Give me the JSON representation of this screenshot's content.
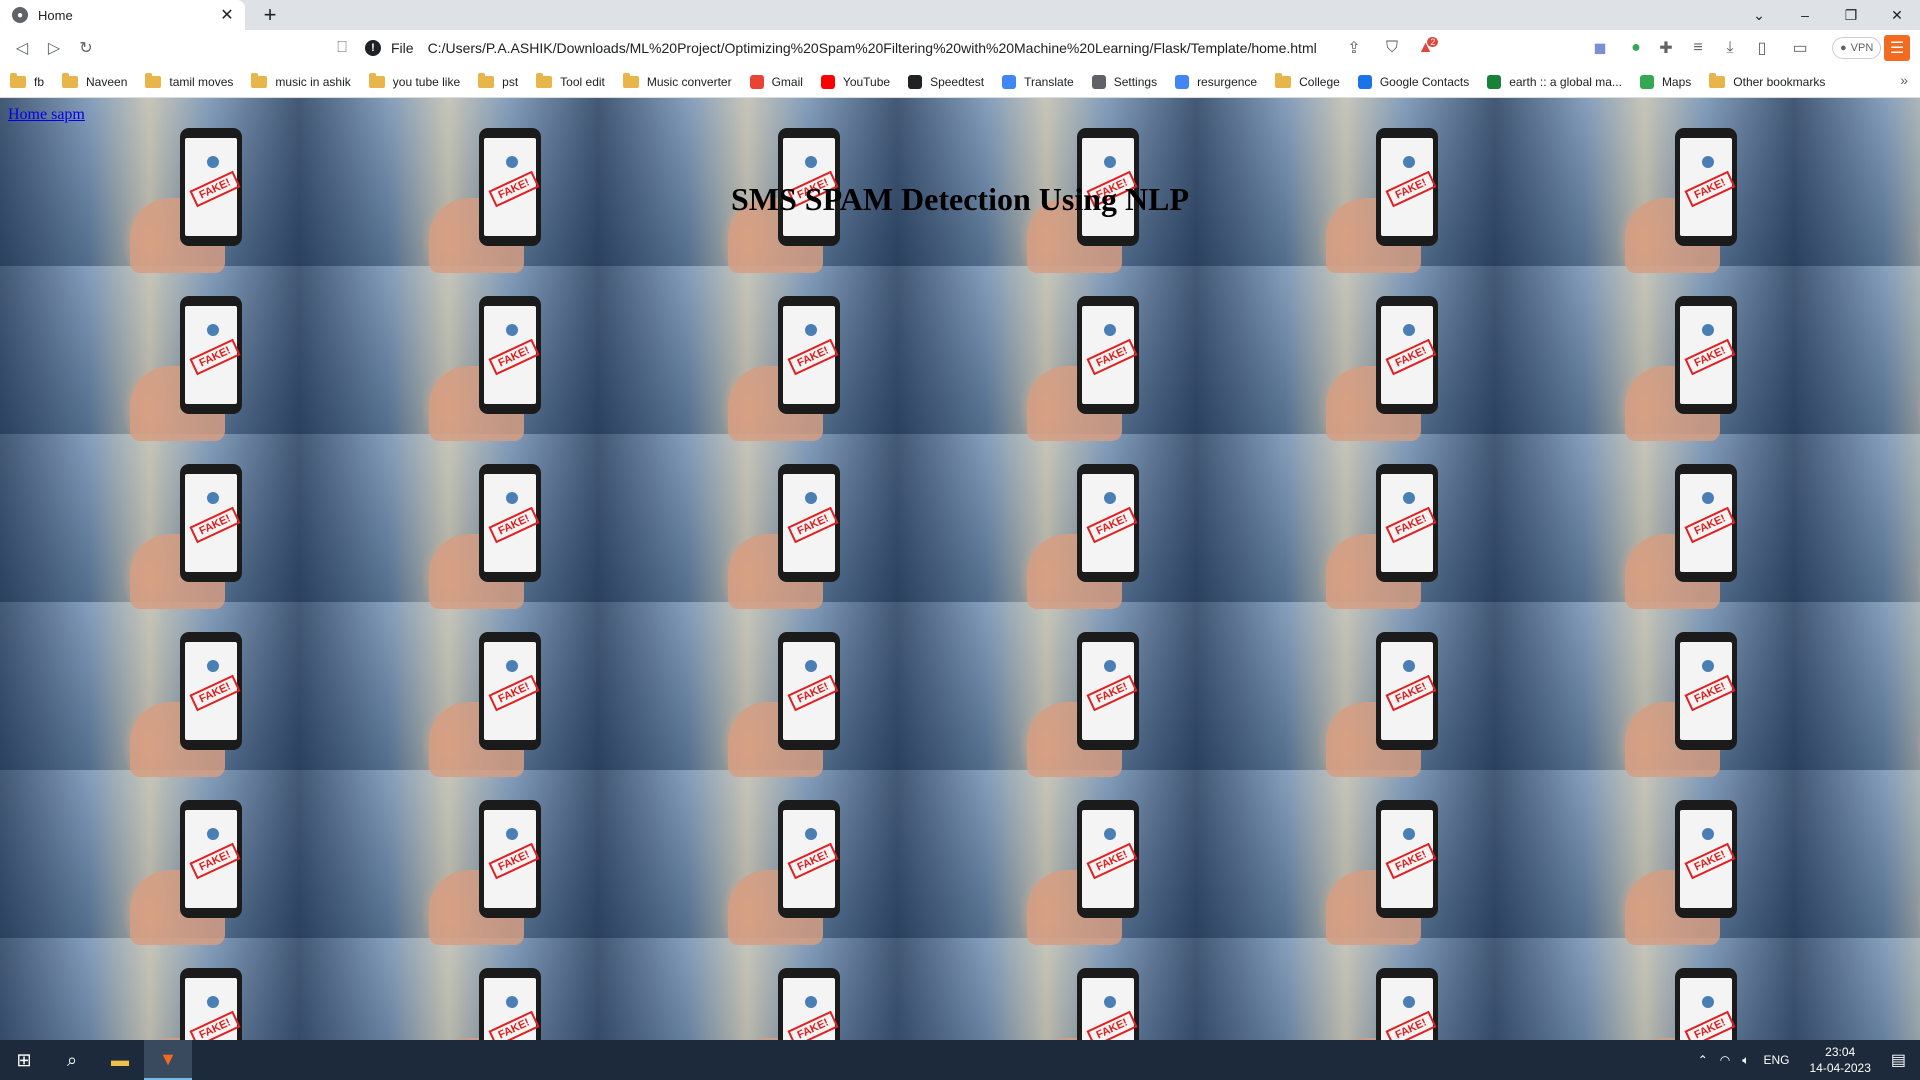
{
  "tab": {
    "title": "Home"
  },
  "address": {
    "scheme": "File",
    "url": "C:/Users/P.A.ASHIK/Downloads/ML%20Project/Optimizing%20Spam%20Filtering%20with%20Machine%20Learning/Flask/Template/home.html"
  },
  "bookmarks": [
    {
      "label": "fb",
      "icon": "folder"
    },
    {
      "label": "Naveen",
      "icon": "folder"
    },
    {
      "label": "tamil moves",
      "icon": "folder"
    },
    {
      "label": "music in ashik",
      "icon": "folder"
    },
    {
      "label": "you tube like",
      "icon": "folder"
    },
    {
      "label": "pst",
      "icon": "folder"
    },
    {
      "label": "Tool edit",
      "icon": "folder"
    },
    {
      "label": "Music converter",
      "icon": "folder"
    },
    {
      "label": "Gmail",
      "icon": "gmail",
      "color": "#ea4335"
    },
    {
      "label": "YouTube",
      "icon": "youtube",
      "color": "#ff0000"
    },
    {
      "label": "Speedtest",
      "icon": "speedtest",
      "color": "#202124"
    },
    {
      "label": "Translate",
      "icon": "translate",
      "color": "#4285f4"
    },
    {
      "label": "Settings",
      "icon": "gear",
      "color": "#5f6368"
    },
    {
      "label": "resurgence",
      "icon": "google",
      "color": "#4285f4"
    },
    {
      "label": "College",
      "icon": "folder"
    },
    {
      "label": "Google Contacts",
      "icon": "contacts",
      "color": "#1a73e8"
    },
    {
      "label": "earth :: a global ma...",
      "icon": "earth",
      "color": "#188038"
    },
    {
      "label": "Maps",
      "icon": "maps",
      "color": "#34a853"
    },
    {
      "label": "Other bookmarks",
      "icon": "folder"
    }
  ],
  "vpn_label": "VPN",
  "brave_badge": "2",
  "page": {
    "link": "Home sapm",
    "heading": "SMS SPAM Detection Using NLP",
    "stamp_text": "FAKE!"
  },
  "taskbar": {
    "lang": "ENG",
    "time": "23:04",
    "date": "14-04-2023"
  }
}
